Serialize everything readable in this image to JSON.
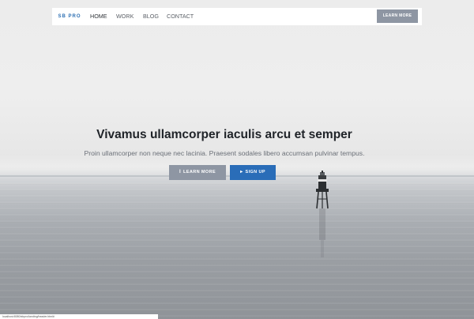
{
  "navbar": {
    "brand": "SB PRO",
    "links": [
      {
        "label": "HOME",
        "active": true
      },
      {
        "label": "WORK",
        "active": false
      },
      {
        "label": "BLOG",
        "active": false
      },
      {
        "label": "CONTACT",
        "active": false
      }
    ],
    "cta_label": "LEARN MORE"
  },
  "hero": {
    "headline": "Vivamus ullamcorper iaculis arcu et semper",
    "subline": "Proin ullamcorper non neque nec lacinia. Praesent sodales libero accumsan pulvinar tempus.",
    "buttons": [
      {
        "label": "LEARN MORE",
        "icon": "info-icon",
        "color": "#8e96a3"
      },
      {
        "label": "SIGN UP",
        "icon": "megaphone-icon",
        "color": "#2a6db8"
      }
    ]
  },
  "status_bar": {
    "url": "localhost:8080/sbpro/landing/header.html#"
  },
  "colors": {
    "accent": "#2a6db8",
    "secondary": "#8e96a3"
  }
}
